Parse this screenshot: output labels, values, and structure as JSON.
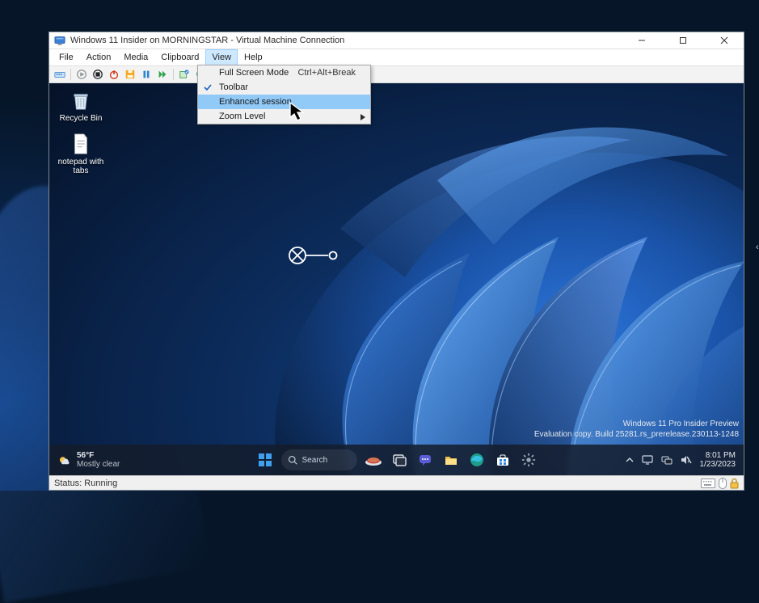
{
  "window": {
    "title": "Windows 11 Insider on MORNINGSTAR - Virtual Machine Connection"
  },
  "menubar": {
    "items": [
      "File",
      "Action",
      "Media",
      "Clipboard",
      "View",
      "Help"
    ],
    "open_index": 4
  },
  "dropdown": {
    "items": [
      {
        "label": "Full Screen Mode",
        "shortcut": "Ctrl+Alt+Break",
        "checked": false,
        "submenu": false,
        "highlighted": false
      },
      {
        "label": "Toolbar",
        "shortcut": "",
        "checked": true,
        "submenu": false,
        "highlighted": false
      },
      {
        "label": "Enhanced session",
        "shortcut": "",
        "checked": false,
        "submenu": false,
        "highlighted": true
      },
      {
        "label": "Zoom Level",
        "shortcut": "",
        "checked": false,
        "submenu": true,
        "highlighted": false
      }
    ]
  },
  "desktop": {
    "icons": [
      {
        "label": "Recycle Bin",
        "type": "recycle-bin"
      },
      {
        "label": "notepad with tabs",
        "type": "text-file"
      }
    ]
  },
  "guest_watermark": {
    "line1": "Windows 11 Pro Insider Preview",
    "line2": "Evaluation copy. Build 25281.rs_prerelease.230113-1248"
  },
  "guest_taskbar": {
    "weather_temp": "56°F",
    "weather_cond": "Mostly clear",
    "search_placeholder": "Search",
    "time": "8:01 PM",
    "date": "1/23/2023"
  },
  "statusbar": {
    "text": "Status: Running"
  }
}
